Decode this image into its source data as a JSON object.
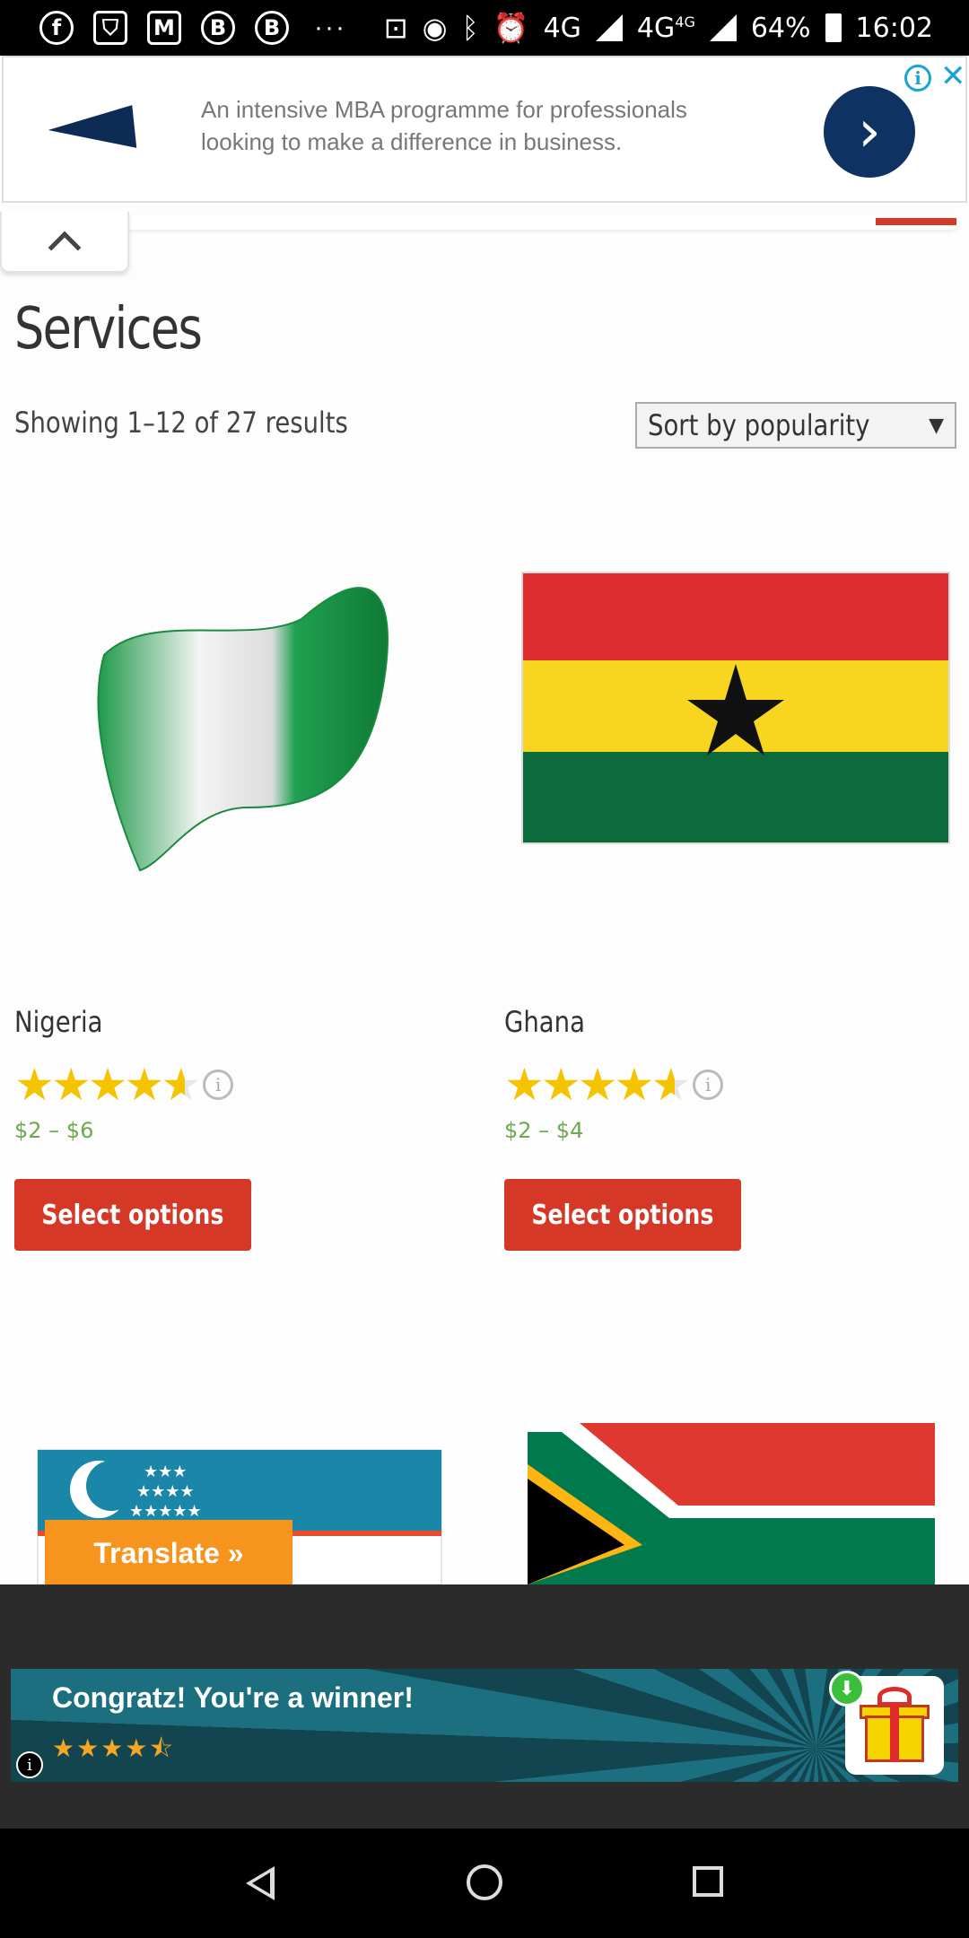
{
  "status_bar": {
    "network_1": "4G",
    "network_2": "4G",
    "network_2_sup": "4G",
    "battery": "64%",
    "time": "16:02"
  },
  "top_ad": {
    "text": "An intensive MBA programme for professionals looking to make a difference in business.",
    "go_icon": "›",
    "info_icon": "i",
    "close_icon": "✕"
  },
  "page": {
    "title": "Services",
    "result_count": "Showing 1–12 of 27 results",
    "sort_selected": "Sort by popularity"
  },
  "products": [
    {
      "name": "Nigeria",
      "price": "$2 – $6",
      "rating": 4.5,
      "button": "Select options",
      "image_icon": "nigeria-flag"
    },
    {
      "name": "Ghana",
      "price": "$2 – $4",
      "rating": 4.5,
      "button": "Select options",
      "image_icon": "ghana-flag"
    }
  ],
  "more_products_images": [
    "uzbekistan-flag",
    "south-africa-flag"
  ],
  "translate_button": "Translate »",
  "bottom_ad": {
    "headline": "Congratz! You're a winner!",
    "rating": 4.5,
    "info_icon": "i"
  },
  "colors": {
    "accent_red": "#d53826",
    "price_green": "#6ea84f",
    "star_gold": "#f5c400",
    "translate_orange": "#f7941d"
  }
}
